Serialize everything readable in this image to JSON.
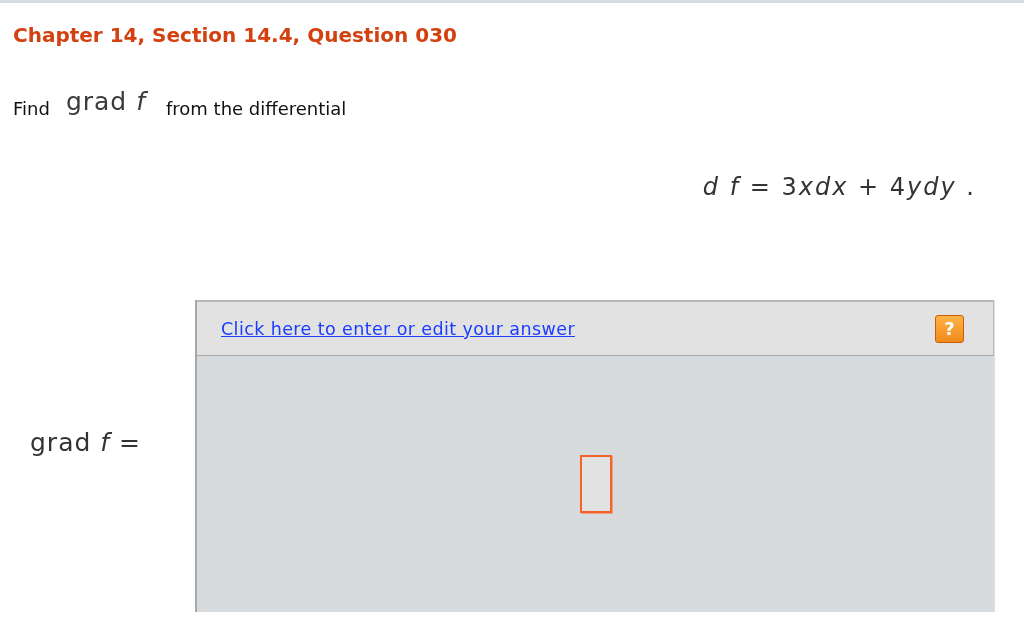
{
  "header": {
    "title": "Chapter 14, Section 14.4, Question 030"
  },
  "prompt": {
    "lead": "Find",
    "expression": "grad *f*",
    "tail": "from the differential"
  },
  "equation": [
    {
      "text": "d f",
      "kind": "variable"
    },
    {
      "text": " = ",
      "kind": "operator"
    },
    {
      "text": "3",
      "kind": "number"
    },
    {
      "text": "xdx",
      "kind": "variable"
    },
    {
      "text": " + ",
      "kind": "operator"
    },
    {
      "text": "4",
      "kind": "number"
    },
    {
      "text": "ydy",
      "kind": "variable"
    },
    {
      "text": " .",
      "kind": "operator"
    }
  ],
  "answer": {
    "label": "grad *f* =",
    "link": "Click here to enter or edit your answer",
    "help": "?"
  }
}
